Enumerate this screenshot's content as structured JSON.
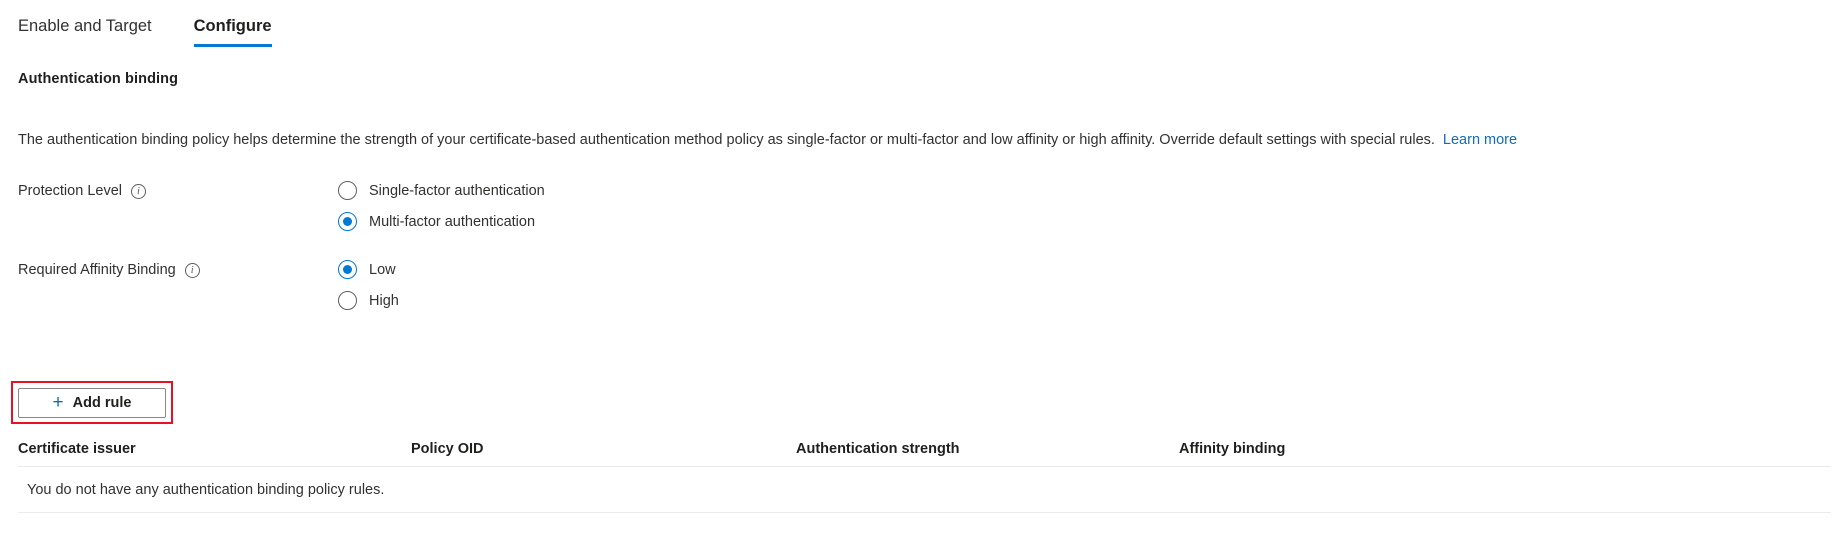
{
  "tabs": [
    {
      "label": "Enable and Target",
      "active": false
    },
    {
      "label": "Configure",
      "active": true
    }
  ],
  "section": {
    "title": "Authentication binding",
    "description": "The authentication binding policy helps determine the strength of your certificate-based authentication method policy as single-factor or multi-factor and low affinity or high affinity. Override default settings with special rules.",
    "learn_more": "Learn more"
  },
  "fields": [
    {
      "label": "Protection Level",
      "info_icon": "info-icon",
      "options": [
        {
          "label": "Single-factor authentication",
          "selected": false
        },
        {
          "label": "Multi-factor authentication",
          "selected": true
        }
      ]
    },
    {
      "label": "Required Affinity Binding",
      "info_icon": "info-icon",
      "options": [
        {
          "label": "Low",
          "selected": true
        },
        {
          "label": "High",
          "selected": false
        }
      ]
    }
  ],
  "add_rule": {
    "label": "Add rule",
    "plus_icon": "plus-icon",
    "highlight_color": "#e81123"
  },
  "table": {
    "columns": [
      "Certificate issuer",
      "Policy OID",
      "Authentication strength",
      "Affinity binding"
    ],
    "empty_message": "You do not have any authentication binding policy rules."
  },
  "colors": {
    "accent": "#0078d4",
    "link": "#0f6cbd",
    "text": "#323130",
    "highlight": "#e81123"
  }
}
